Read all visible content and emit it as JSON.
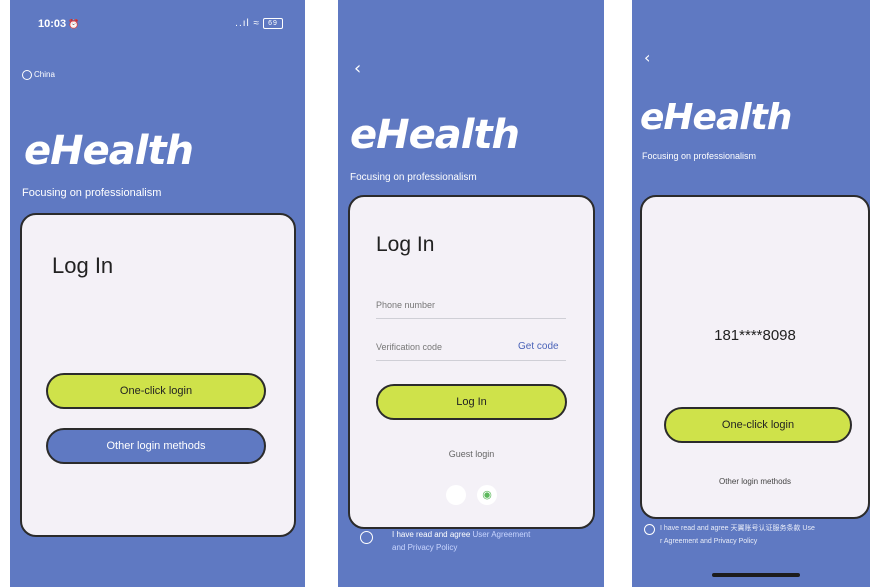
{
  "screens": [
    {
      "status_time": "10:03",
      "status_extra": "⏰",
      "signal": "..ıl ≈",
      "battery": "69",
      "region": "China",
      "brand": "eHealth",
      "tagline": "Focusing on professionalism",
      "title": "Log In",
      "primary_button": "One-click login",
      "secondary_button": "Other login methods"
    },
    {
      "back": "‹",
      "brand": "eHealth",
      "tagline": "Focusing on professionalism",
      "title": "Log In",
      "phone_placeholder": "Phone number",
      "code_placeholder": "Verification code",
      "get_code": "Get code",
      "login_button": "Log In",
      "guest": "Guest login",
      "apple_icon": "",
      "wechat_icon": "◉",
      "agree_text": "I have read and agree",
      "agree_link_1": "User Agreement",
      "agree_link_2": "and Privacy Policy"
    },
    {
      "back": "‹",
      "brand": "eHealth",
      "tagline": "Focusing on professionalism",
      "masked_phone": "181****8098",
      "primary_button": "One-click login",
      "other": "Other login methods",
      "agree_line1": "I have read and agree 天翼账号认证服务条款 Use",
      "agree_line2": "r Agreement and Privacy Policy"
    }
  ],
  "colors": {
    "screen_bg": "#5f79c2",
    "accent_green": "#cfe24a",
    "card_bg": "#f4f1f7",
    "link": "#4a63b8"
  }
}
